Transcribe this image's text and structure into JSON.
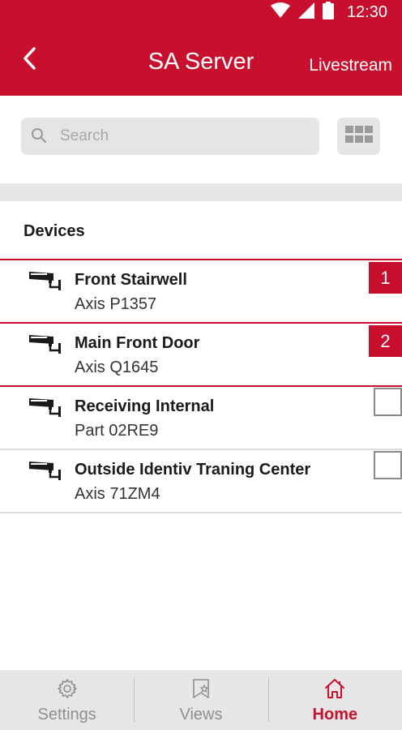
{
  "status_bar": {
    "time": "12:30",
    "icons": [
      "wifi-icon",
      "cell-signal-icon",
      "battery-icon"
    ]
  },
  "app_bar": {
    "title": "SA Server",
    "back_icon": "chevron-left-icon",
    "action_label": "Livestream"
  },
  "search": {
    "placeholder": "Search",
    "value": "",
    "grid_icon": "grid-view-icon"
  },
  "devices": {
    "heading": "Devices",
    "items": [
      {
        "name": "Front Stairwell",
        "model": "Axis P1357",
        "selected": true,
        "order": "1"
      },
      {
        "name": "Main Front Door",
        "model": "Axis Q1645",
        "selected": true,
        "order": "2"
      },
      {
        "name": "Receiving Internal",
        "model": "Part 02RE9",
        "selected": false,
        "order": ""
      },
      {
        "name": "Outside Identiv Traning Center",
        "model": "Axis 71ZM4",
        "selected": false,
        "order": ""
      }
    ]
  },
  "bottom_nav": {
    "items": [
      {
        "label": "Settings",
        "icon": "gear-icon",
        "active": false
      },
      {
        "label": "Views",
        "icon": "views-star-icon",
        "active": false
      },
      {
        "label": "Home",
        "icon": "home-icon",
        "active": true
      }
    ]
  },
  "colors": {
    "brand": "#c8102e",
    "nav_background": "#e6e6e6",
    "search_background": "#e5e5e5"
  }
}
